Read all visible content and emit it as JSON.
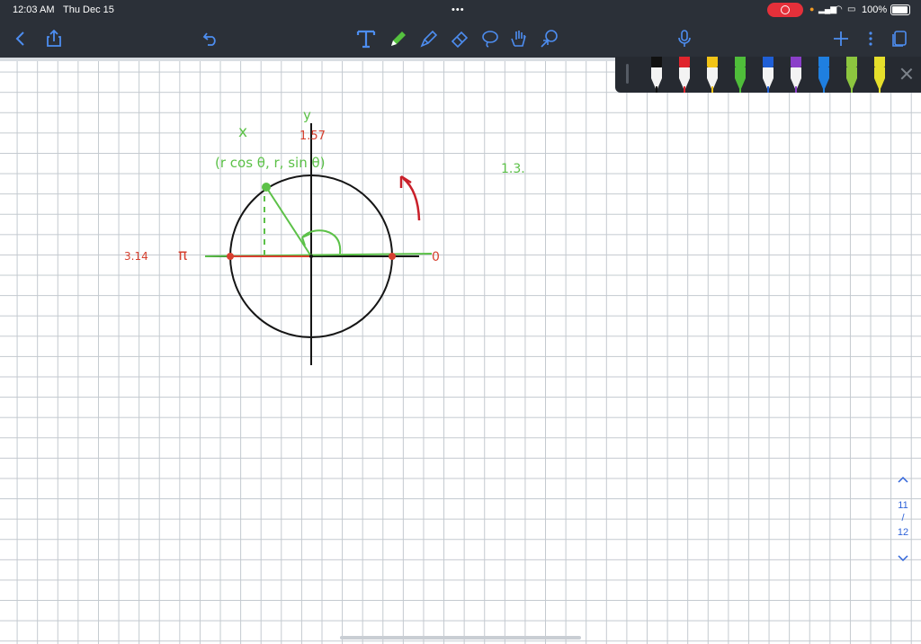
{
  "status": {
    "time": "12:03 AM",
    "date": "Thu Dec 15",
    "battery": "100%"
  },
  "toolbar": {
    "icons": [
      "back-icon",
      "share-icon",
      "undo-icon",
      "text-tool-icon",
      "pen-icon",
      "highlighter-icon",
      "eraser-icon",
      "lasso-icon",
      "hand-icon",
      "shapes-icon",
      "mic-icon",
      "add-icon",
      "more-icon",
      "pages-icon"
    ]
  },
  "pens": [
    {
      "color": "#111111",
      "filled": false
    },
    {
      "color": "#e0252d",
      "filled": false
    },
    {
      "color": "#f2c417",
      "filled": false
    },
    {
      "color": "#4fbd3a",
      "filled": true
    },
    {
      "color": "#1f5fd6",
      "filled": false
    },
    {
      "color": "#8b3fc9",
      "filled": false
    },
    {
      "color": "#1f7fe0",
      "filled": true
    },
    {
      "color": "#8dc63f",
      "filled": true
    },
    {
      "color": "#e6df2b",
      "filled": true
    }
  ],
  "notes": {
    "x_label": "x",
    "y_label": "y",
    "top_value": "1.57",
    "coords": "(r cos θ, r, sin θ)",
    "left_value": "3.14",
    "pi": "π",
    "right_value": "0",
    "side_note": "1.3."
  },
  "pager": {
    "current": "11",
    "total": "12",
    "sep": "/"
  }
}
